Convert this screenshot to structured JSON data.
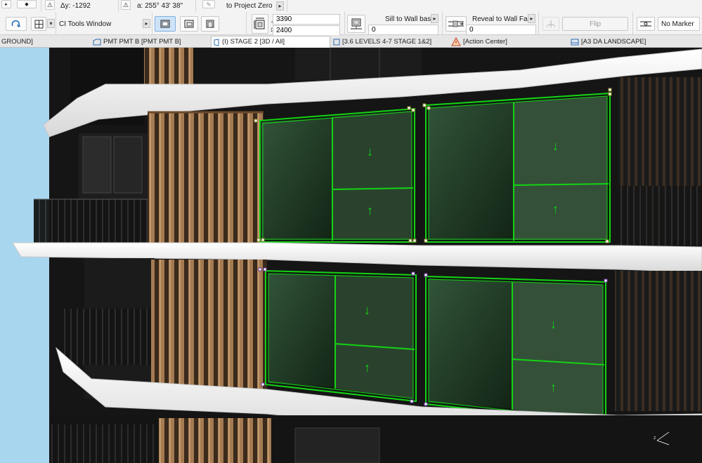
{
  "toolbar": {
    "dy_label": "Δy: -1292",
    "angle_label": "a: 255° 43' 38\"",
    "project_zero_label": "to Project Zero",
    "tools_window_label": "CI Tools Window",
    "width_value": "3390",
    "height_value": "2400",
    "sill_label": "Sill to Wall base",
    "sill_value": "0",
    "reveal_label": "Reveal to Wall Face",
    "reveal_value": "0",
    "flip_label": "Flip",
    "marker_label": "No Marker"
  },
  "tabs": [
    {
      "label": "GROUND]"
    },
    {
      "label": "PMT PMT B [PMT PMT B]"
    },
    {
      "label": "(I) STAGE 2 [3D / All]"
    },
    {
      "label": "[3.6 LEVELS 4-7 STAGE 1&2]"
    },
    {
      "label": "[Action Center]"
    },
    {
      "label": "[A3 DA LANDSCAPE]"
    }
  ],
  "colors": {
    "selection": "#14d314",
    "sky": "#a8d6ef",
    "slab": "#f2f2f2",
    "timber": "#a57b52",
    "glass_dark": "#1d2a20"
  },
  "icons": [
    "rotate-icon",
    "grid-icon",
    "window-icon",
    "door-icon",
    "dimension-icon",
    "sill-icon",
    "reveal-icon",
    "flip-icon",
    "marker-icon",
    "layout-icon",
    "warning-icon"
  ]
}
